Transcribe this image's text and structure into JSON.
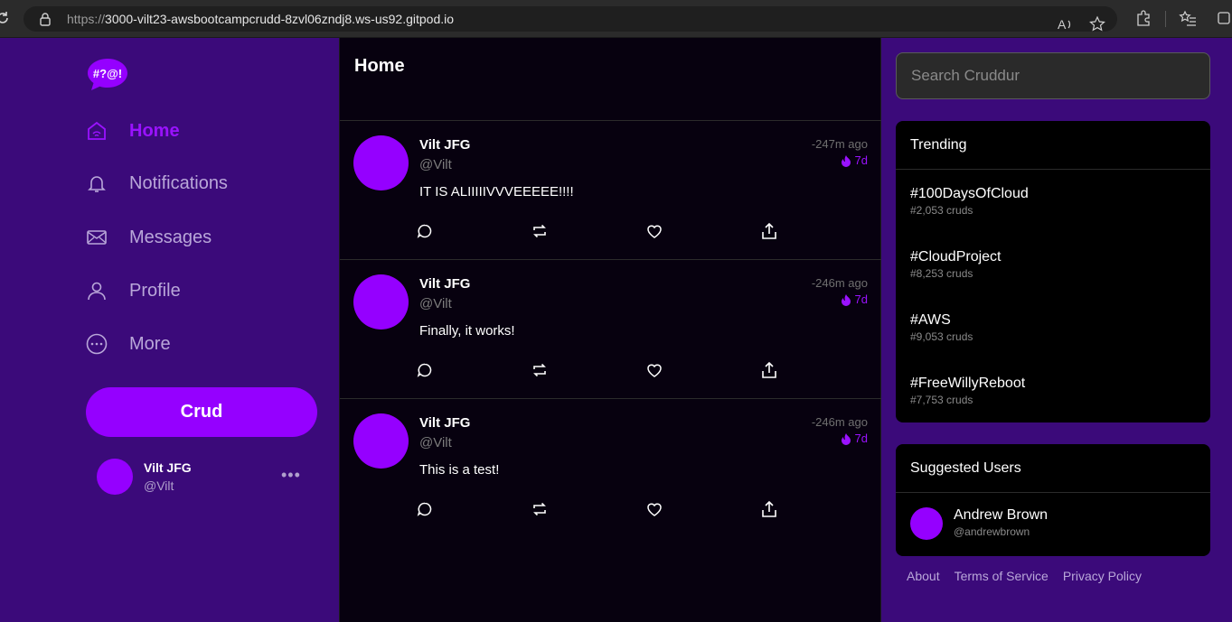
{
  "browser": {
    "url_prefix": "https://",
    "url_host": "3000-vilt23-awsbootcampcrudd-8zvl06zndj8.ws-us92.gitpod.io"
  },
  "logo_text": "#?@!",
  "nav": [
    {
      "label": "Home",
      "icon": "home-icon",
      "active": true
    },
    {
      "label": "Notifications",
      "icon": "bell-icon"
    },
    {
      "label": "Messages",
      "icon": "mail-icon"
    },
    {
      "label": "Profile",
      "icon": "user-icon"
    },
    {
      "label": "More",
      "icon": "more-icon"
    }
  ],
  "crud_button": "Crud",
  "current_user": {
    "name": "Vilt JFG",
    "handle": "@Vilt",
    "menu": "•••"
  },
  "feed": {
    "title": "Home",
    "posts": [
      {
        "name": "Vilt JFG",
        "handle": "@Vilt",
        "message": "IT IS ALIIIIIVVVEEEEE!!!!",
        "time": "-247m ago",
        "expires": "7d"
      },
      {
        "name": "Vilt JFG",
        "handle": "@Vilt",
        "message": "Finally, it works!",
        "time": "-246m ago",
        "expires": "7d"
      },
      {
        "name": "Vilt JFG",
        "handle": "@Vilt",
        "message": "This is a test!",
        "time": "-246m ago",
        "expires": "7d"
      }
    ]
  },
  "search": {
    "placeholder": "Search Cruddur"
  },
  "trending": {
    "title": "Trending",
    "items": [
      {
        "tag": "#100DaysOfCloud",
        "count": "#2,053 cruds"
      },
      {
        "tag": "#CloudProject",
        "count": "#8,253 cruds"
      },
      {
        "tag": "#AWS",
        "count": "#9,053 cruds"
      },
      {
        "tag": "#FreeWillyReboot",
        "count": "#7,753 cruds"
      }
    ]
  },
  "suggested": {
    "title": "Suggested Users",
    "users": [
      {
        "name": "Andrew Brown",
        "handle": "@andrewbrown"
      }
    ]
  },
  "footer": {
    "about": "About",
    "terms": "Terms of Service",
    "privacy": "Privacy Policy"
  },
  "colors": {
    "accent": "#9500ff",
    "sidebar_bg": "#3b0a7a",
    "feed_bg": "#07010f"
  }
}
